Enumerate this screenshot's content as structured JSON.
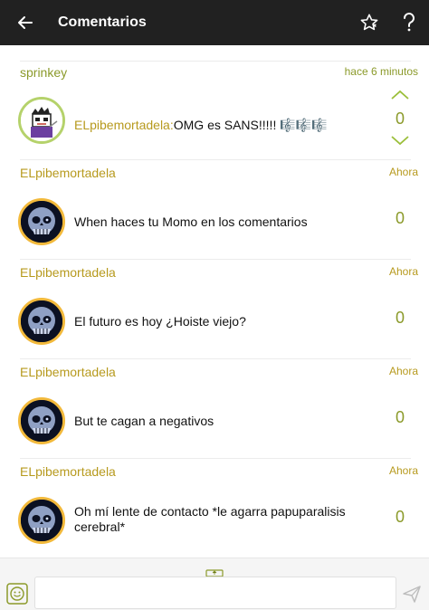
{
  "topbar": {
    "title": "Comentarios",
    "icons": [
      "back-arrow-icon",
      "star-icon",
      "help-icon"
    ]
  },
  "comments": [
    {
      "username": "sprinkey",
      "time": "hace 6 minutos",
      "mention": "ELpibemortadela:",
      "text": "OMG es SANS!!!!! 🎼🎼🎼",
      "score": "0",
      "avatar": "pixel-character-avatar"
    },
    {
      "username": "ELpibemortadela",
      "time": "Ahora",
      "text": "When haces tu Momo en los comentarios",
      "score": "0",
      "avatar": "skull-avatar"
    },
    {
      "username": "ELpibemortadela",
      "time": "Ahora",
      "text": "El futuro es hoy ¿Hoiste viejo?",
      "score": "0",
      "avatar": "skull-avatar"
    },
    {
      "username": "ELpibemortadela",
      "time": "Ahora",
      "text": "But te cagan a negativos",
      "score": "0",
      "avatar": "skull-avatar"
    },
    {
      "username": "ELpibemortadela",
      "time": "Ahora",
      "text": "Oh mí lente de contacto *le agarra papuparalisis cerebral*",
      "score": "0",
      "avatar": "skull-avatar"
    }
  ],
  "composer": {
    "input_value": "",
    "icons": [
      "emoji-icon",
      "send-icon",
      "expand-handle-icon"
    ]
  }
}
